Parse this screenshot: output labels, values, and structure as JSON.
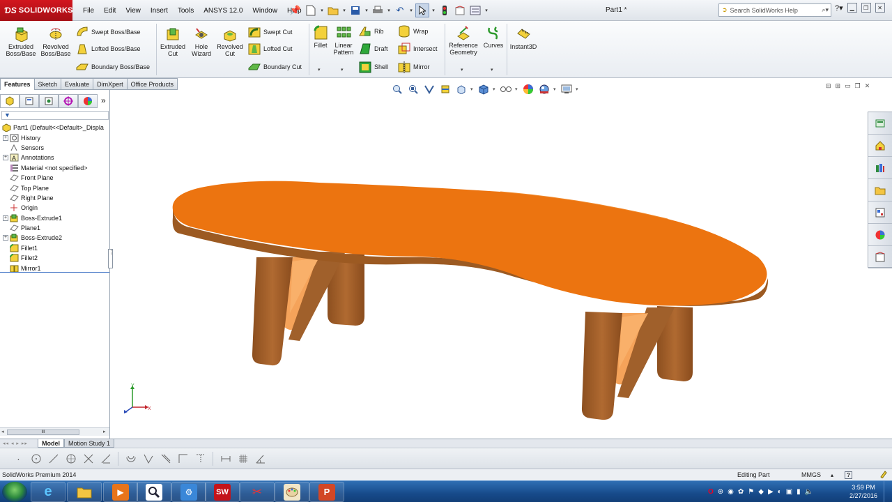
{
  "app": {
    "logo": "SOLIDWORKS",
    "menus": [
      "File",
      "Edit",
      "View",
      "Insert",
      "Tools",
      "ANSYS 12.0",
      "Window",
      "Help"
    ],
    "document_title": "Part1 *",
    "search_placeholder": "Search SolidWorks Help"
  },
  "command_manager": {
    "extruded_boss": "Extruded\nBoss/Base",
    "revolved_boss": "Revolved\nBoss/Base",
    "swept_boss": "Swept Boss/Base",
    "lofted_boss": "Lofted Boss/Base",
    "boundary_boss": "Boundary Boss/Base",
    "extruded_cut": "Extruded\nCut",
    "hole_wizard": "Hole\nWizard",
    "revolved_cut": "Revolved\nCut",
    "swept_cut": "Swept Cut",
    "lofted_cut": "Lofted Cut",
    "boundary_cut": "Boundary Cut",
    "fillet": "Fillet",
    "linear_pattern": "Linear\nPattern",
    "rib": "Rib",
    "draft": "Draft",
    "shell": "Shell",
    "wrap": "Wrap",
    "intersect": "Intersect",
    "mirror": "Mirror",
    "reference_geometry": "Reference\nGeometry",
    "curves": "Curves",
    "instant3d": "Instant3D"
  },
  "tabs": [
    "Features",
    "Sketch",
    "Evaluate",
    "DimXpert",
    "Office Products"
  ],
  "feature_tree": [
    {
      "label": "Part1  (Default<<Default>_Displa",
      "icon": "part-icon",
      "expand": "none",
      "root": true
    },
    {
      "label": "History",
      "icon": "history-icon",
      "expand": "+"
    },
    {
      "label": "Sensors",
      "icon": "sensors-icon",
      "expand": ""
    },
    {
      "label": "Annotations",
      "icon": "annotations-icon",
      "expand": "+"
    },
    {
      "label": "Material <not specified>",
      "icon": "material-icon",
      "expand": ""
    },
    {
      "label": "Front Plane",
      "icon": "plane-icon",
      "expand": ""
    },
    {
      "label": "Top Plane",
      "icon": "plane-icon",
      "expand": ""
    },
    {
      "label": "Right Plane",
      "icon": "plane-icon",
      "expand": ""
    },
    {
      "label": "Origin",
      "icon": "origin-icon",
      "expand": ""
    },
    {
      "label": "Boss-Extrude1",
      "icon": "extrude-icon",
      "expand": "+"
    },
    {
      "label": "Plane1",
      "icon": "plane-icon",
      "expand": ""
    },
    {
      "label": "Boss-Extrude2",
      "icon": "extrude-icon",
      "expand": "+"
    },
    {
      "label": "Fillet1",
      "icon": "fillet-icon",
      "expand": ""
    },
    {
      "label": "Fillet2",
      "icon": "fillet-icon",
      "expand": ""
    },
    {
      "label": "Mirror1",
      "icon": "mirror-icon",
      "expand": ""
    }
  ],
  "bottom_tabs": [
    "Model",
    "Motion Study 1"
  ],
  "status": {
    "product": "SolidWorks Premium 2014",
    "mode": "Editing Part",
    "units": "MMGS",
    "help": "?"
  },
  "triad": {
    "y": "Y",
    "x": "X"
  },
  "clock": {
    "time": "3:59 PM",
    "date": "2/27/2016"
  },
  "colors": {
    "table_top": "#EC7410",
    "table_edge": "#9C5A22",
    "leg": "#A8642E",
    "leg_inner": "#F9A55A",
    "logo_red": "#C4141B"
  }
}
